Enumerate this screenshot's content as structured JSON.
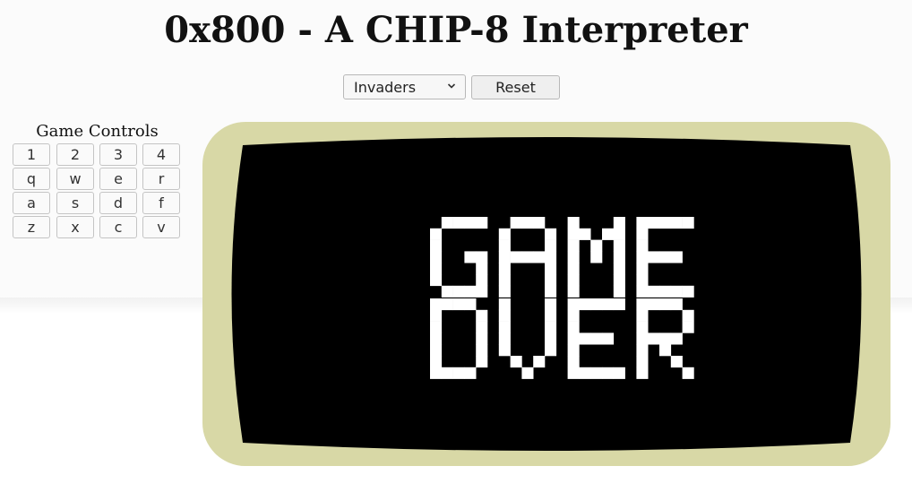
{
  "page": {
    "title": "0x800 - A CHIP-8 Interpreter"
  },
  "toolbar": {
    "rom_select_value": "Invaders",
    "reset_label": "Reset"
  },
  "controls": {
    "title": "Game Controls",
    "keys": [
      "1",
      "2",
      "3",
      "4",
      "q",
      "w",
      "e",
      "r",
      "a",
      "s",
      "d",
      "f",
      "z",
      "x",
      "c",
      "v"
    ]
  },
  "screen": {
    "bezel_color": "#d8d8a6",
    "background_color": "#000000",
    "pixel_color": "#ffffff",
    "message_lines": [
      "GAME",
      "OVER"
    ]
  }
}
